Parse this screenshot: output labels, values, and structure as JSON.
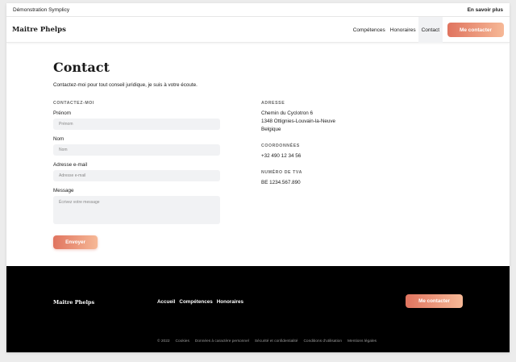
{
  "demo_bar": {
    "title": "Démonstration Symplicy",
    "learn_more": "En savoir plus"
  },
  "nav": {
    "brand": "Maitre Phelps",
    "links": [
      "Compétences",
      "Honoraires",
      "Contact"
    ],
    "cta": "Me contacter"
  },
  "page": {
    "title": "Contact",
    "intro": "Contactez-moi pour tout conseil juridique, je suis à votre écoute."
  },
  "form": {
    "section_label": "CONTACTEZ-MOI",
    "fields": [
      {
        "label": "Prénom",
        "placeholder": "Prénom"
      },
      {
        "label": "Nom",
        "placeholder": "Nom"
      },
      {
        "label": "Adresse e-mail",
        "placeholder": "Adresse e-mail"
      },
      {
        "label": "Message",
        "placeholder": "Écrivez votre message"
      }
    ],
    "submit": "Envoyer"
  },
  "info": {
    "address_label": "ADRESSE",
    "address_lines": [
      "Chemin du Cyclotron 6",
      "1348 Ottignies-Louvain-la-Neuve",
      "Belgique"
    ],
    "contact_label": "COORDONNÉES",
    "phone": "+32 490 12 34 56",
    "vat_label": "NUMÉRO DE TVA",
    "vat": "BE 1234.567.890"
  },
  "footer": {
    "brand": "Maitre Phelps",
    "links": [
      "Accueil",
      "Compétences",
      "Honoraires"
    ],
    "cta": "Me contacter",
    "legal": [
      "© 2022",
      "Cookies",
      "Données à caractère personnel",
      "Sécurité et confidentialité",
      "Conditions d'utilisation",
      "Mentions légales"
    ]
  }
}
